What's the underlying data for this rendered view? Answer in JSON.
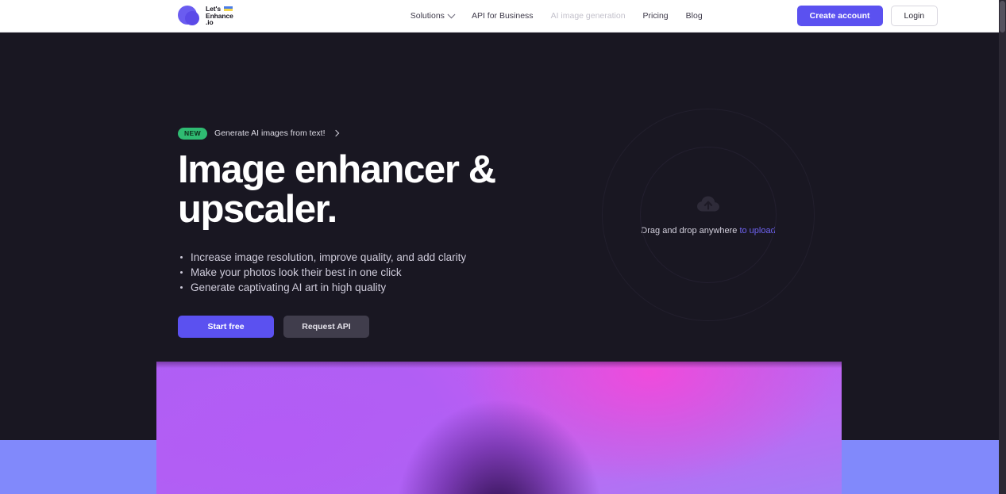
{
  "brand": {
    "name_line1": "Let's",
    "name_line2": "Enhance",
    "name_line3": ".io",
    "logo_icon": "lets-enhance-blob-logo",
    "flag_icon": "ukraine-flag-icon"
  },
  "nav": {
    "items": [
      {
        "label": "Solutions",
        "dim": false,
        "has_chevron": true
      },
      {
        "label": "API for Business",
        "dim": false,
        "has_chevron": false
      },
      {
        "label": "AI image generation",
        "dim": true,
        "has_chevron": false
      },
      {
        "label": "Pricing",
        "dim": false,
        "has_chevron": false
      },
      {
        "label": "Blog",
        "dim": false,
        "has_chevron": false
      }
    ]
  },
  "topbar_actions": {
    "create_account_label": "Create account",
    "login_label": "Login"
  },
  "hero": {
    "badge": {
      "tag": "NEW",
      "text": "Generate AI images from text!",
      "arrow_icon": "chevron-right-icon"
    },
    "title": "Image enhancer & upscaler.",
    "bullets": [
      "Increase image resolution, improve quality, and add clarity",
      "Make your photos look their best in one click",
      "Generate captivating AI art in high quality"
    ],
    "cta": {
      "primary_label": "Start free",
      "secondary_label": "Request API"
    }
  },
  "dropzone": {
    "icon": "cloud-upload-icon",
    "text_static": "Drag and drop anywhere ",
    "text_link": "to upload"
  },
  "colors": {
    "background": "#191722",
    "accent_purple": "#5b51f0",
    "badge_green": "#2fbb72",
    "upload_link": "#6f63f2",
    "band_periwinkle": "#8189fb",
    "topbar_white": "#ffffff"
  }
}
